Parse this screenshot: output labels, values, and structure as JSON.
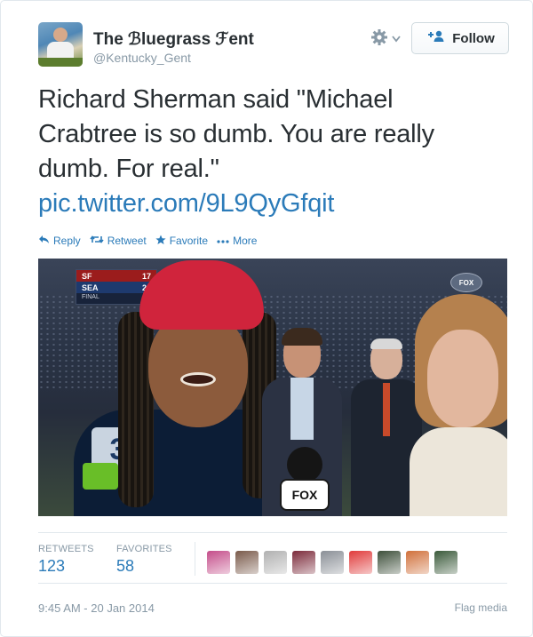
{
  "tweet": {
    "author": {
      "display_name": "The ℬluegrass ℱent",
      "handle": "@Kentucky_Gent"
    },
    "header_actions": {
      "settings_icon": "gear-icon",
      "follow_label": "Follow"
    },
    "text_lines": [
      "Richard Sherman said \"Michael",
      "Crabtree is so dumb. You are really",
      "dumb. For real.\""
    ],
    "link": "pic.twitter.com/9L9QyGfqit",
    "actions": [
      {
        "icon": "reply-icon",
        "label": "Reply"
      },
      {
        "icon": "retweet-icon",
        "label": "Retweet"
      },
      {
        "icon": "favorite-star-icon",
        "label": "Favorite"
      },
      {
        "icon": "more-dots-icon",
        "label": "More"
      }
    ],
    "media": {
      "scoreboard": {
        "team1": "SF",
        "score1": "17",
        "team2": "SEA",
        "score2": "23",
        "status": "FINAL"
      },
      "network_logo": "FOX",
      "jersey_number": "3",
      "mic_flag": "FOX"
    },
    "stats": {
      "retweets_label": "RETWEETS",
      "retweets_value": "123",
      "favorites_label": "FAVORITES",
      "favorites_value": "58"
    },
    "favoriters_colors": [
      "#c44d8a",
      "#7a5a4a",
      "#b0b0b0",
      "#7c2a3a",
      "#8a8f96",
      "#e03a3a",
      "#3d4f3a",
      "#d0703a",
      "#3a5a3a"
    ],
    "timestamp": "9:45 AM - 20 Jan 2014",
    "flag_media": "Flag media",
    "colors": {
      "link": "#2b7bb9",
      "text": "#292f33",
      "muted": "#8899a6"
    }
  }
}
